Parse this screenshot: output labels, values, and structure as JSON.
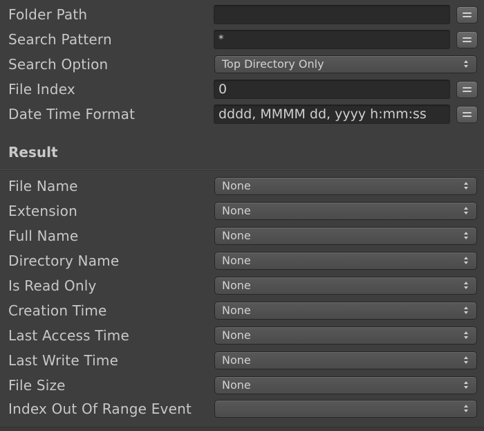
{
  "settings": {
    "folder_path": {
      "label": "Folder Path",
      "value": ""
    },
    "search_pattern": {
      "label": "Search Pattern",
      "value": "*"
    },
    "search_option": {
      "label": "Search Option",
      "value": "Top Directory Only"
    },
    "file_index": {
      "label": "File Index",
      "value": "0"
    },
    "date_time_format": {
      "label": "Date Time Format",
      "value": "dddd, MMMM dd, yyyy h:mm:ss"
    }
  },
  "result": {
    "title": "Result",
    "items": [
      {
        "label": "File Name",
        "value": "None"
      },
      {
        "label": "Extension",
        "value": "None"
      },
      {
        "label": "Full Name",
        "value": "None"
      },
      {
        "label": "Directory Name",
        "value": "None"
      },
      {
        "label": "Is Read Only",
        "value": "None"
      },
      {
        "label": "Creation Time",
        "value": "None"
      },
      {
        "label": "Last Access Time",
        "value": "None"
      },
      {
        "label": "Last Write Time",
        "value": "None"
      },
      {
        "label": "File Size",
        "value": "None"
      },
      {
        "label": "Index Out Of Range Event",
        "value": ""
      }
    ]
  },
  "icons": {
    "variable_toggle": "equals-icon",
    "dropdown": "up-down-arrows-icon"
  },
  "colors": {
    "background": "#3e3e3e",
    "text": "#c8c8c8",
    "field": "#2a2a2a",
    "dropdown": "#545454"
  }
}
